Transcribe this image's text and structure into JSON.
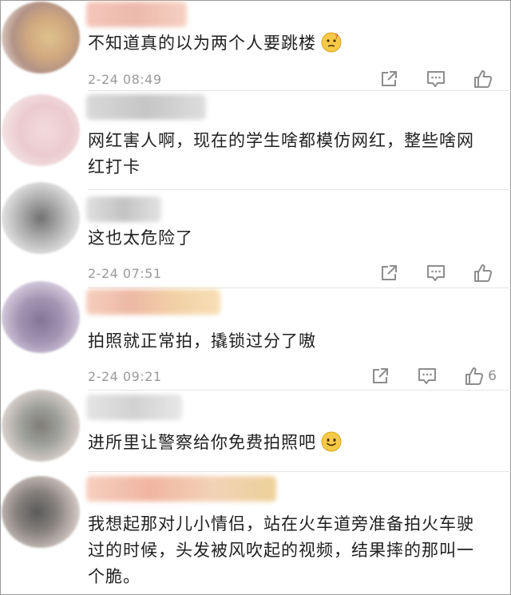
{
  "comments": [
    {
      "text": "不知道真的以为两个人要跳楼",
      "emoji": "thinking-face-icon",
      "time": "2-24 08:49",
      "likes": "",
      "avatar_color": "#c9a87a",
      "name_color": "#e8b0a0"
    },
    {
      "text": "网红害人啊，现在的学生啥都模仿网红，整些啥网红打卡",
      "emoji": "",
      "time": "",
      "likes": "",
      "avatar_color": "#e9c8cc",
      "name_color": "#bdbdbd"
    },
    {
      "text": "这也太危险了",
      "emoji": "",
      "time": "2-24 07:51",
      "likes": "",
      "avatar_color": "#8c8c8c",
      "name_color": "#c6c6c6"
    },
    {
      "text": "拍照就正常拍，撬锁过分了嗷",
      "emoji": "",
      "time": "2-24 09:21",
      "likes": "6",
      "avatar_color": "#8e7aa0",
      "name_color": "#e9b8a0"
    },
    {
      "text": "进所里让警察给你免费拍照吧",
      "emoji": "smile-face-icon",
      "time": "",
      "likes": "",
      "avatar_color": "#7a8a86",
      "name_color": "#cfcfcf"
    },
    {
      "text": "我想起那对儿小情侣，站在火车道旁准备拍火车驶过的时候，头发被风吹起的视频，结果摔的那叫一个脆。",
      "emoji": "",
      "time": "",
      "likes": "",
      "avatar_color": "#6e6e6e",
      "name_color": "#e8b89a"
    }
  ],
  "colors": {
    "icon": "#8d8d8d",
    "time": "#9a9a9a",
    "text": "#1f1f1f",
    "divider": "#e5e5e5"
  }
}
